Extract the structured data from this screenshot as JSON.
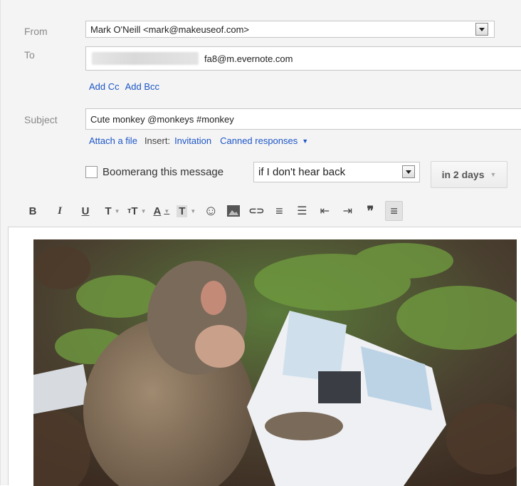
{
  "compose": {
    "from_label": "From",
    "from_value": "Mark O'Neill <mark@makeuseof.com>",
    "to_label": "To",
    "to_value": "fa8@m.evernote.com",
    "add_cc": "Add Cc",
    "add_bcc": "Add Bcc",
    "subject_label": "Subject",
    "subject_value": "Cute monkey @monkeys #monkey",
    "attach_file": "Attach a file",
    "insert_label": "Insert:",
    "invitation": "Invitation",
    "canned_responses": "Canned responses",
    "boomerang_label": "Boomerang this message",
    "boomerang_checked": false,
    "boomerang_condition": "if I don't hear back",
    "boomerang_time": "in 2 days"
  },
  "toolbar": [
    {
      "name": "bold-button",
      "glyph": "B"
    },
    {
      "name": "italic-button",
      "glyph": "I"
    },
    {
      "name": "underline-button",
      "glyph": "U"
    },
    {
      "name": "font-button",
      "glyph": "T"
    },
    {
      "name": "font-size-button",
      "glyph": "T"
    },
    {
      "name": "text-color-button",
      "glyph": "A"
    },
    {
      "name": "highlight-color-button",
      "glyph": "T"
    },
    {
      "name": "emoji-button",
      "glyph": "☺"
    },
    {
      "name": "insert-image-button",
      "glyph": ""
    },
    {
      "name": "insert-link-button",
      "glyph": "⊂⊃"
    },
    {
      "name": "numbered-list-button",
      "glyph": "≡"
    },
    {
      "name": "bulleted-list-button",
      "glyph": "☰"
    },
    {
      "name": "indent-less-button",
      "glyph": "⇤"
    },
    {
      "name": "indent-more-button",
      "glyph": "⇥"
    },
    {
      "name": "quote-button",
      "glyph": "❞"
    },
    {
      "name": "align-button",
      "glyph": "≡"
    }
  ],
  "colors": {
    "link": "#1c55c6",
    "label": "#8a8a8a",
    "panel_bg": "#f4f4f4"
  }
}
